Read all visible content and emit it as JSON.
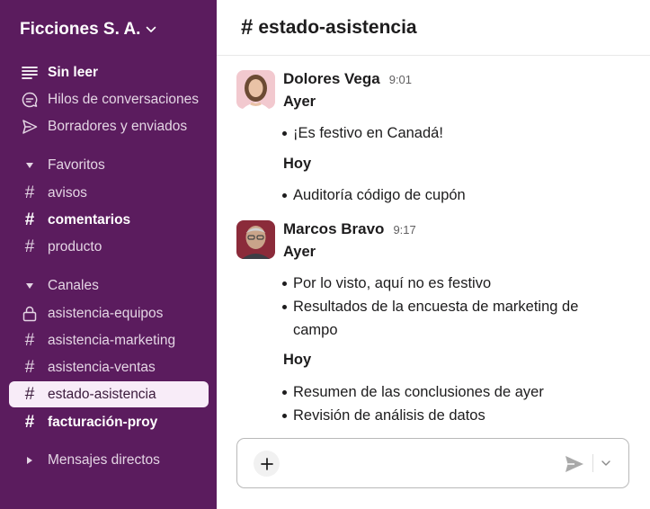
{
  "workspace": {
    "name": "Ficciones S. A."
  },
  "sidebar": {
    "top_items": [
      {
        "label": "Sin leer",
        "icon": "unread-lines-icon"
      },
      {
        "label": "Hilos de conversaciones",
        "icon": "threads-icon"
      },
      {
        "label": "Borradores y enviados",
        "icon": "send-icon"
      }
    ],
    "favoritos": {
      "label": "Favoritos",
      "channels": [
        "avisos",
        "comentarios",
        "producto"
      ]
    },
    "canales": {
      "label": "Canales",
      "channels": [
        "asistencia-equipos",
        "asistencia-marketing",
        "asistencia-ventas",
        "estado-asistencia",
        "facturación-proy"
      ]
    },
    "dms": {
      "label": "Mensajes directos"
    }
  },
  "channel": {
    "hash": "#",
    "name": "estado-asistencia"
  },
  "messages": [
    {
      "sender": "Dolores Vega",
      "time": "9:01",
      "groups": [
        {
          "day": "Ayer",
          "items": [
            "¡Es festivo en Canadá!"
          ]
        },
        {
          "day": "Hoy",
          "items": [
            "Auditoría código de cupón"
          ]
        }
      ]
    },
    {
      "sender": "Marcos Bravo",
      "time": "9:17",
      "groups": [
        {
          "day": "Ayer",
          "items": [
            "Por lo visto, aquí no es festivo",
            "Resultados de la encuesta de marketing de campo"
          ]
        },
        {
          "day": "Hoy",
          "items": [
            "Resumen de las conclusiones de ayer",
            "Revisión de análisis de datos"
          ]
        }
      ]
    }
  ],
  "composer": {
    "value": ""
  },
  "colors": {
    "sidebar_bg": "#5b1c5e",
    "active_item_bg": "#f8ecf8",
    "text_primary": "#1d1c1d"
  }
}
